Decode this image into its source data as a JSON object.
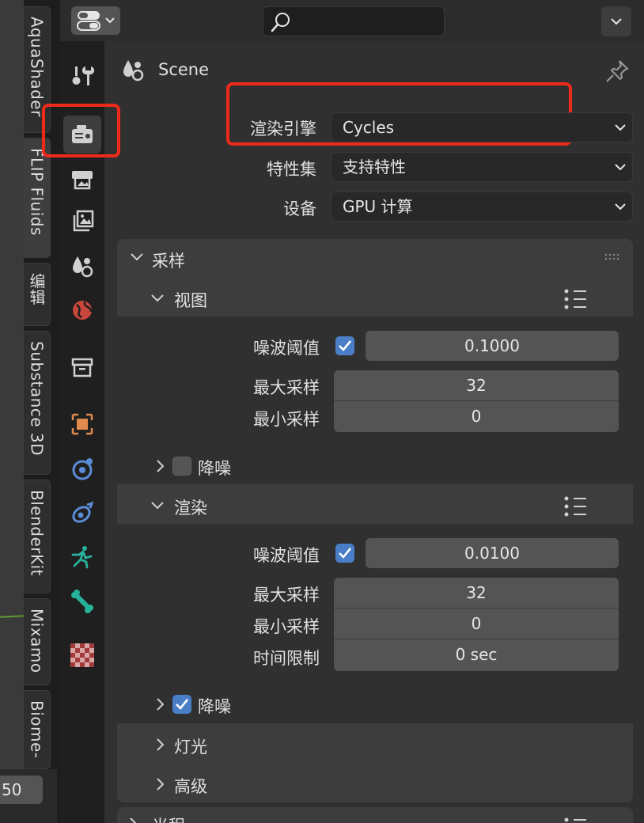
{
  "sidebar_tabs": [
    {
      "label": "AquaShader",
      "active": false
    },
    {
      "label": "FLIP Fluids",
      "active": true
    },
    {
      "label": "编辑",
      "active": false
    },
    {
      "label": "Substance 3D",
      "active": false
    },
    {
      "label": "BlenderKit",
      "active": false
    },
    {
      "label": "Mixamo",
      "active": false
    },
    {
      "label": "Biome-",
      "active": false
    }
  ],
  "frame_value": "50",
  "header": {
    "search_value": ""
  },
  "scene": {
    "title": "Scene"
  },
  "render": {
    "engine_label": "渲染引擎",
    "engine_value": "Cycles",
    "feature_set_label": "特性集",
    "feature_set_value": "支持特性",
    "device_label": "设备",
    "device_value": "GPU 计算"
  },
  "sampling": {
    "title": "采样",
    "viewport": {
      "title": "视图",
      "noise_threshold_label": "噪波阈值",
      "noise_threshold_enabled": true,
      "noise_threshold_value": "0.1000",
      "max_samples_label": "最大采样",
      "max_samples_value": "32",
      "min_samples_label": "最小采样",
      "min_samples_value": "0",
      "denoise_label": "降噪",
      "denoise_enabled": false
    },
    "render": {
      "title": "渲染",
      "noise_threshold_label": "噪波阈值",
      "noise_threshold_enabled": true,
      "noise_threshold_value": "0.0100",
      "max_samples_label": "最大采样",
      "max_samples_value": "32",
      "min_samples_label": "最小采样",
      "min_samples_value": "0",
      "time_limit_label": "时间限制",
      "time_limit_value": "0 sec",
      "denoise_label": "降噪",
      "denoise_enabled": true
    },
    "lights_title": "灯光",
    "advanced_title": "高级"
  },
  "next_panel_title": "光程",
  "colors": {
    "accent": "#4a7fc8",
    "annotation": "#ee2a1a"
  }
}
